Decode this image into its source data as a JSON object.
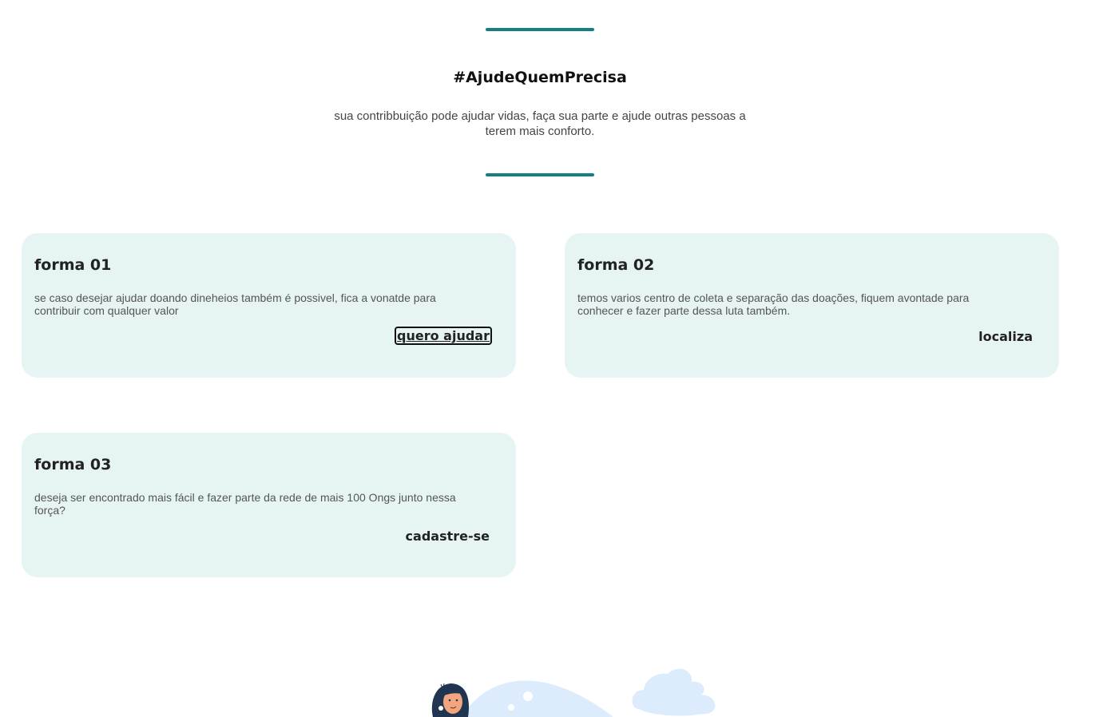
{
  "hero": {
    "title": "#AjudeQuemPrecisa",
    "subtitle": "sua contribbuição pode ajudar vidas, faça sua parte e ajude outras pessoas a terem mais conforto."
  },
  "cards": [
    {
      "title": "forma 01",
      "text": "se caso desejar ajudar doando dineheios também é possivel, fica a vonatde para contribuir com qualquer valor",
      "action": "quero ajudar"
    },
    {
      "title": "forma 02",
      "text": "temos varios centro de coleta e separação das doações, fiquem avontade para conhecer e fazer parte dessa luta também.",
      "action": "localiza"
    },
    {
      "title": "forma 03",
      "text": "deseja ser encontrado mais fácil e fazer parte da rede de mais 100 Ongs junto nessa força?",
      "action": "cadastre-se"
    }
  ],
  "colors": {
    "accent": "#157f84",
    "card_background": "#e6f5f3",
    "illustration_blue": "#dcecfd"
  },
  "illustration": {
    "icons": [
      "person-avatar-icon",
      "hill-icon",
      "cloud-icon"
    ]
  }
}
